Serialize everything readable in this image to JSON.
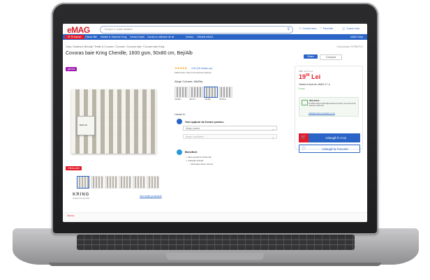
{
  "header": {
    "logo": "eMAG",
    "search_placeholder": "Începe o nouă căutare",
    "account": "Contul meu",
    "favorites": "Favorite",
    "cart": "Coșul meu"
  },
  "nav": {
    "products": "Produse",
    "items": [
      "Oferta Zilei",
      "Nutriție & Vitamine Drug",
      "Genius Deals",
      "Cardul cu milioane de lei",
      "Genius",
      "Ofertele eMAG"
    ],
    "help": "eMAG Help"
  },
  "breadcrumb": "Casa, Gradina & Bricolaj / Textile & Covoare / Covoare / Covoare baie / Covoare baie Kring",
  "product_code": "Cod produs: E1FB1F0 II",
  "title": "Covoras baie Kring Chenille, 1600 gsm, 50x80 cm, Bej/Alb",
  "share": "Share",
  "compare": "Compara",
  "genius": "genius",
  "stars": "★★★★★",
  "rating": "4.92 (15 review-uri)",
  "recommend": "100% dintre clienti recomanda produsul",
  "color_label": "Alege Culoare: Alb/Bej",
  "swatches": [
    "Alb/Bla...",
    "Alb/Gri...",
    "Alb/Bej",
    "Alb/Roz"
  ],
  "delivery_label": "Livrare în:",
  "delivery_options_title": "Vezi opțiuni de livrare pentru:",
  "select_county": "Alege județul",
  "select_city": "Alege localitatea",
  "benefits_title": "Beneficii:",
  "benefits": [
    "Retur gratuit în 30 de zile",
    "Garanție inclusă",
    "Persoane fizice: 24 luni"
  ],
  "offer_badge": "Oferta zilei",
  "brand": "KRING",
  "brand_sub": "HOME COLLECTION",
  "brand_link": "Vezi toate produsele",
  "price_box": {
    "prev": "PRP: 24,71 Lei",
    "price_main": "19",
    "price_cents": "99",
    "currency": "Lei",
    "seller": "Vândut și livrat de: eMAG 4.7 ★",
    "stock": "În stoc",
    "extra_title": "-30% Extra",
    "extra_desc": "Ai 30% extra la achiziția acestui produs, la comenzi de minimum 100 Lei!",
    "extra_link": "Adaugă toate produsele in cos",
    "add_to_cart": "Adaugă în Coș",
    "add_to_fav": "Adaugă la Favorite"
  },
  "footer_hint": "Vezi și"
}
